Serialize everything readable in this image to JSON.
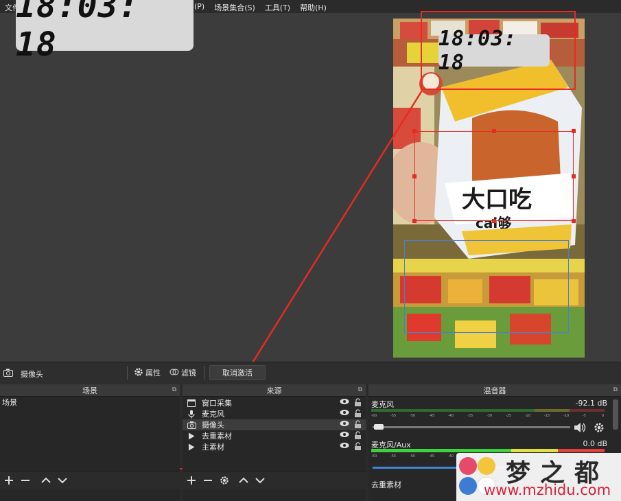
{
  "menubar": {
    "left_partial": "文件",
    "items": [
      "(P)",
      "场景集合(S)",
      "工具(T)",
      "帮助(H)"
    ]
  },
  "clock": {
    "time_big": "18:03: 18",
    "time_small": "18:03: 18"
  },
  "toolbar": {
    "current_source": "摄像头",
    "properties_label": "属性",
    "filters_label": "滤镜",
    "deactivate_label": "取消激活"
  },
  "scenes": {
    "title": "场景",
    "items": [
      "场景"
    ]
  },
  "sources": {
    "title": "来源",
    "items": [
      {
        "label": "窗口采集",
        "icon": "window-icon"
      },
      {
        "label": "麦克风",
        "icon": "microphone-icon"
      },
      {
        "label": "摄像头",
        "icon": "camera-icon"
      },
      {
        "label": "去重素材",
        "icon": "play-icon"
      },
      {
        "label": "主素材",
        "icon": "play-icon"
      }
    ],
    "selected_index": 2
  },
  "mixer": {
    "title": "混音器",
    "tracks": [
      {
        "name": "麦克风",
        "db": "-92.1 dB"
      },
      {
        "name": "麦克风/Aux",
        "db": "0.0 dB"
      },
      {
        "name": "去重素材",
        "db": ""
      }
    ],
    "tick_labels": [
      "-60",
      "-55",
      "-50",
      "-45",
      "-40",
      "-35",
      "-30",
      "-25",
      "-20",
      "-15",
      "-10",
      "-5",
      "0"
    ]
  },
  "watermark": {
    "title": "梦之都",
    "url": "www.mzhidu.com"
  },
  "colors": {
    "highlight_red": "#e52b22",
    "selection_blue": "#4a7fd1",
    "watermark_red": "#d6213a"
  }
}
